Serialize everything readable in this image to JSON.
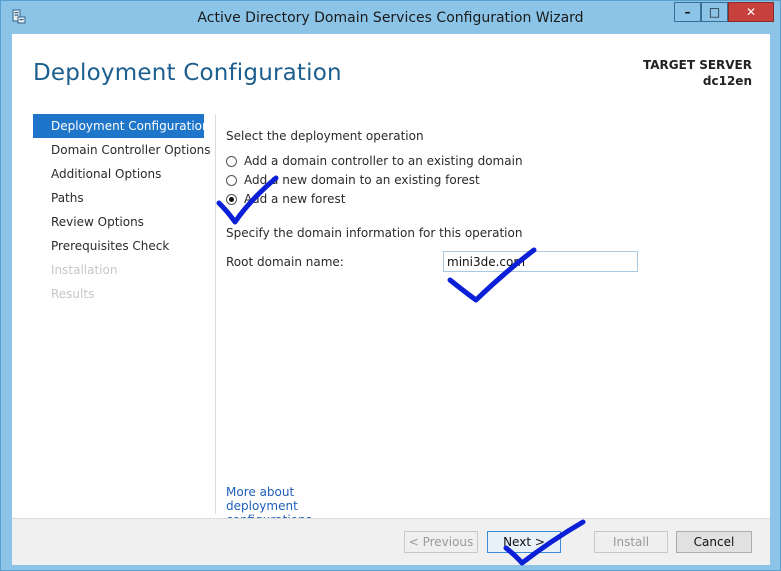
{
  "window": {
    "title": "Active Directory Domain Services Configuration Wizard",
    "icon": "server-manager-icon",
    "controls": {
      "minimize": "–",
      "maximize": "□",
      "close": "✕"
    }
  },
  "header": {
    "title": "Deployment Configuration",
    "target_server_label": "TARGET SERVER",
    "target_server_name": "dc12en"
  },
  "nav": {
    "items": [
      {
        "label": "Deployment Configuration",
        "state": "active"
      },
      {
        "label": "Domain Controller Options",
        "state": "normal"
      },
      {
        "label": "Additional Options",
        "state": "normal"
      },
      {
        "label": "Paths",
        "state": "normal"
      },
      {
        "label": "Review Options",
        "state": "normal"
      },
      {
        "label": "Prerequisites Check",
        "state": "normal"
      },
      {
        "label": "Installation",
        "state": "disabled"
      },
      {
        "label": "Results",
        "state": "disabled"
      }
    ]
  },
  "content": {
    "operation_heading": "Select the deployment operation",
    "options": [
      {
        "label": "Add a domain controller to an existing domain",
        "checked": false
      },
      {
        "label": "Add a new domain to an existing forest",
        "checked": false
      },
      {
        "label": "Add a new forest",
        "checked": true
      }
    ],
    "domain_info_heading": "Specify the domain information for this operation",
    "root_domain_label": "Root domain name:",
    "root_domain_value": "mini3de.com",
    "more_link": "More about deployment configurations"
  },
  "footer": {
    "previous": "< Previous",
    "next": "Next >",
    "install": "Install",
    "cancel": "Cancel"
  },
  "colors": {
    "accent": "#1f75c9",
    "title_blue": "#1c5e8e",
    "window_frame": "#8cc4e8",
    "annotation_ink": "#0b1fd6"
  }
}
